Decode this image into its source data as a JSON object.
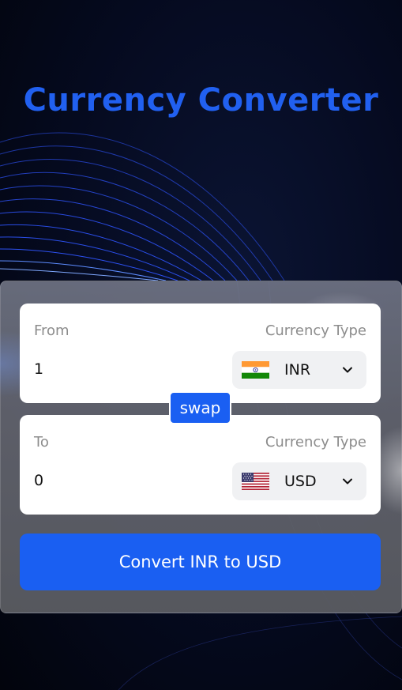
{
  "app": {
    "title": "Currency Converter"
  },
  "from": {
    "label": "From",
    "currency_type_label": "Currency Type",
    "amount": "1",
    "currency": "INR",
    "flag_icon": "india-flag-icon"
  },
  "to": {
    "label": "To",
    "currency_type_label": "Currency Type",
    "amount": "0",
    "currency": "USD",
    "flag_icon": "us-flag-icon"
  },
  "swap_label": "swap",
  "convert_label": "Convert INR to USD",
  "colors": {
    "accent": "#1a5ff2",
    "title": "#2160f0",
    "background": "#050a1f"
  }
}
